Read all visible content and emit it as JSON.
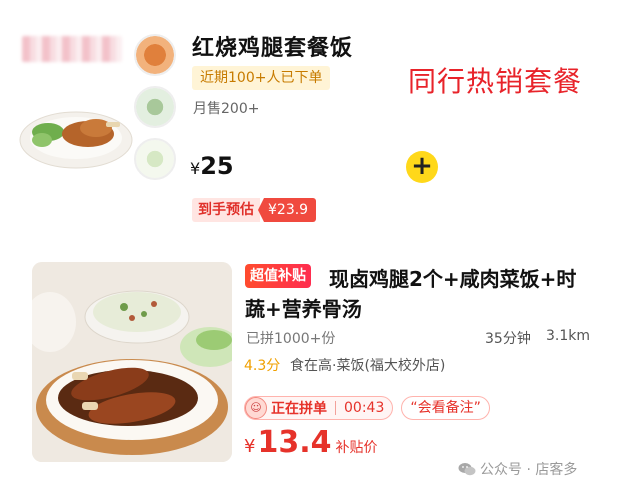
{
  "card1": {
    "title": "红烧鸡腿套餐饭",
    "recent_badge": "近期100+人已下单",
    "monthly_sales": "月售200+",
    "price_symbol": "¥",
    "price": "25",
    "final_label": "到手预估",
    "final_price": "¥23.9",
    "overlay_caption": "同行热销套餐",
    "add_button": "+"
  },
  "card2": {
    "badge": "超值补贴",
    "title": "现卤鸡腿2个+咸肉菜饭+时蔬+营养骨汤",
    "sold": "已拼1000+份",
    "eta": "35分钟",
    "distance": "3.1km",
    "rating": "4.3分",
    "shop": "食在高·菜饭(福大校外店)",
    "group_status": "正在拼单",
    "countdown": "00:43",
    "note": "“会看备注”",
    "price_symbol": "¥",
    "price": "13.4",
    "price_suffix": "补贴价"
  },
  "watermark": "公众号 · 店客多",
  "colors": {
    "brand_red": "#e8232a",
    "price_red": "#e6322a",
    "yellow": "#ffd81a",
    "orange": "#f0a000"
  },
  "icons": {
    "add": "plus-icon",
    "group_avatar": "avatar-icon",
    "watermark": "wechat-icon"
  }
}
